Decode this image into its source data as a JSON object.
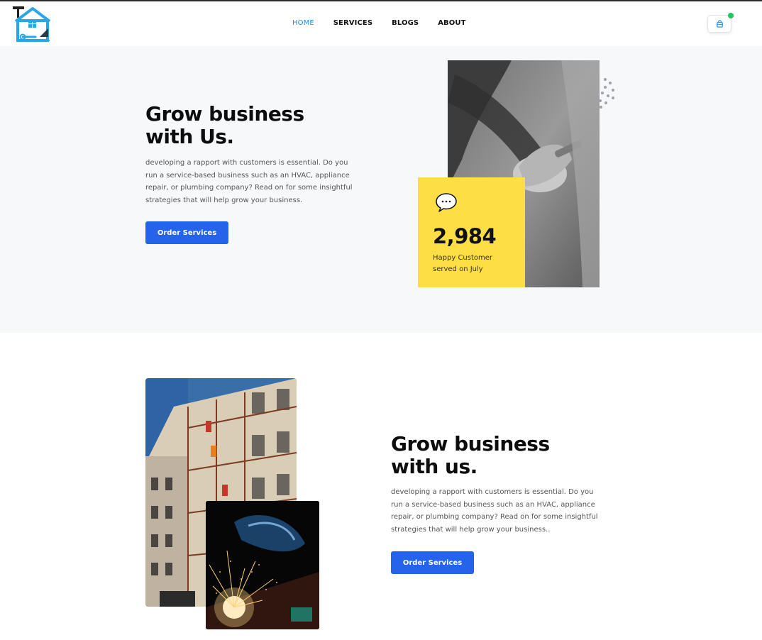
{
  "header": {
    "nav": [
      {
        "label": "HOME",
        "active": true
      },
      {
        "label": "SERVICES",
        "active": false
      },
      {
        "label": "BLOGS",
        "active": false
      },
      {
        "label": "ABOUT",
        "active": false
      }
    ],
    "cart_icon": "shopping-bag-icon",
    "cart_badge_color": "#22c55e",
    "logo_icon": "house-tools-logo"
  },
  "hero": {
    "title_line1": "Grow business",
    "title_line2": "with Us.",
    "description": "developing a rapport with customers is essential. Do you run a service-based business such as an HVAC, appliance repair, or plumbing company? Read on for some insightful strategies that will help grow your business.",
    "button_label": "Order Services",
    "stat": {
      "icon": "chat-bubble-icon",
      "value": "2,984",
      "label_line1": "Happy Customer",
      "label_line2": "served on July"
    }
  },
  "section2": {
    "title_line1": "Grow business",
    "title_line2": "with us.",
    "description": "developing a rapport with customers is essential. Do you run a service-based business such as an HVAC, appliance repair, or plumbing company? Read on for some insightful strategies that will help grow your business..",
    "button_label": "Order Services"
  },
  "colors": {
    "accent_blue": "#2563eb",
    "nav_active": "#1d8fd8",
    "stat_card_yellow": "#fddf45",
    "hero_bg": "#f7f8fa"
  }
}
